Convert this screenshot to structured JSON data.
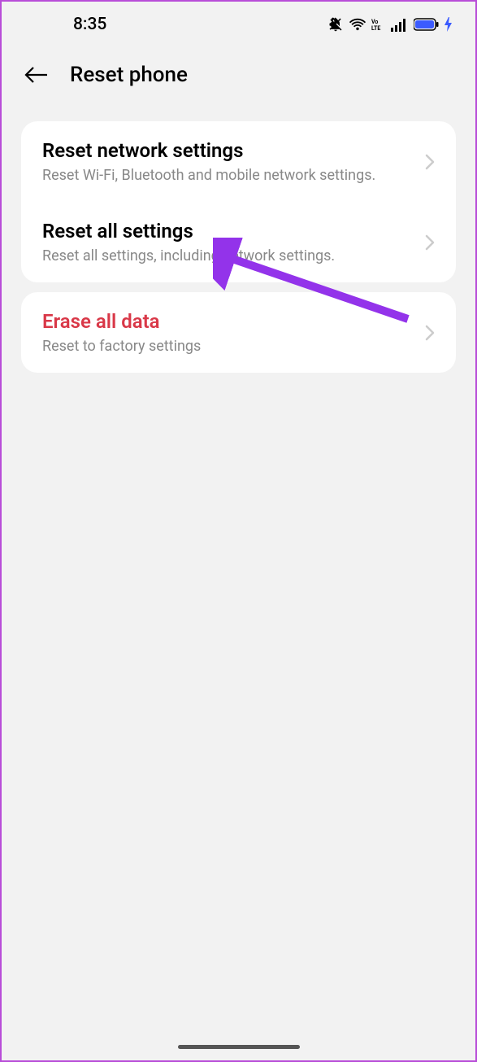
{
  "status": {
    "time": "8:35"
  },
  "header": {
    "title": "Reset phone"
  },
  "group1": {
    "items": [
      {
        "title": "Reset network settings",
        "subtitle": "Reset Wi-Fi, Bluetooth and mobile network settings."
      },
      {
        "title": "Reset all settings",
        "subtitle": "Reset all settings, including network settings."
      }
    ]
  },
  "group2": {
    "items": [
      {
        "title": "Erase all data",
        "subtitle": "Reset to factory settings"
      }
    ]
  }
}
